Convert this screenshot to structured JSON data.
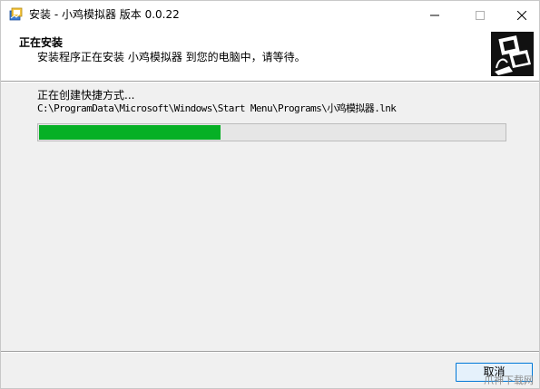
{
  "window": {
    "title": "安装 - 小鸡模拟器 版本 0.0.22"
  },
  "header": {
    "title": "正在安装",
    "subtitle": "安装程序正在安装 小鸡模拟器 到您的电脑中，请等待。"
  },
  "main": {
    "status_text": "正在创建快捷方式...",
    "current_path": "C:\\ProgramData\\Microsoft\\Windows\\Start Menu\\Programs\\小鸡模拟器.lnk",
    "progress": 0.39
  },
  "footer": {
    "cancel_label": "取消"
  },
  "watermark": "爪神下载网",
  "colors": {
    "progress_fill": "#06b025",
    "progress_track": "#e6e6e6",
    "button_border": "#0078d7"
  },
  "icons": {
    "app": "installer-app-icon",
    "minimize": "minimize-icon",
    "maximize": "maximize-icon",
    "close": "close-icon",
    "header_logo": "setup-computer-logo-icon"
  }
}
